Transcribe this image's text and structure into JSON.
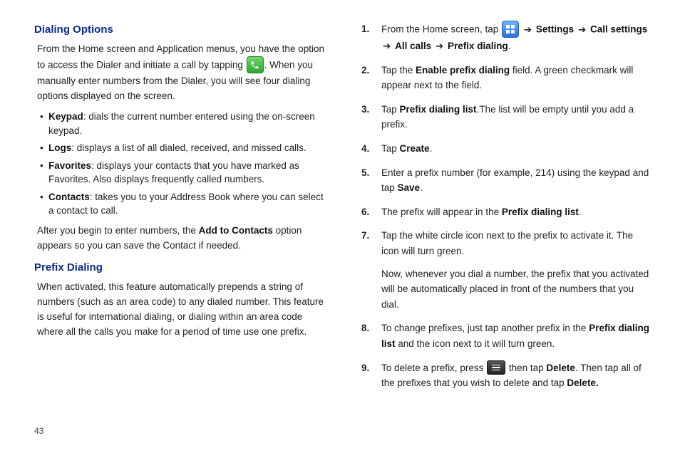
{
  "page_number": "43",
  "left": {
    "section1_title": "Dialing Options",
    "p1a": "From the Home screen and Application menus, you have the option to access the Dialer and initiate a call by tapping ",
    "p1b": ". When you manually enter numbers from the Dialer, you will see four dialing options displayed on the screen.",
    "bullets": [
      {
        "label": "Keypad",
        "text": ": dials the current number entered using the on-screen keypad."
      },
      {
        "label": "Logs",
        "text": ": displays a list of all dialed, received, and missed calls."
      },
      {
        "label": "Favorites",
        "text": ": displays your contacts that you have marked as Favorites. Also displays frequently called numbers."
      },
      {
        "label": "Contacts",
        "text": ": takes you to your Address Book where you can select a contact to call."
      }
    ],
    "p_after_bullets_a": "After you begin to enter numbers, the ",
    "add_to_contacts": "Add to Contacts",
    "p_after_bullets_b": " option appears so you can save the Contact if needed.",
    "section2_title": "Prefix Dialing",
    "p_prefix": "When activated, this feature automatically prepends a string of numbers (such as an area code) to any dialed number. This feature is useful for international dialing, or dialing within an area code where all the calls you make for a period of time use one prefix."
  },
  "right": {
    "arrow": "➔",
    "step1_a": "From the Home screen, tap ",
    "step1_settings": "Settings",
    "step1_callsettings": "Call settings",
    "step1_allcalls": "All calls",
    "step1_prefixdialing": "Prefix dialing",
    "step1_period": ".",
    "step2_a": "Tap the ",
    "step2_b": "Enable prefix dialing",
    "step2_c": " field. A green checkmark will appear next to the field.",
    "step3_a": "Tap ",
    "step3_b": "Prefix dialing list",
    "step3_c": ".The list will be empty until you add a prefix.",
    "step4_a": "Tap ",
    "step4_b": "Create",
    "step4_c": ".",
    "step5_a": "Enter a prefix number (for example, 214) using the keypad and tap ",
    "step5_b": "Save",
    "step5_c": ".",
    "step6_a": "The prefix will appear in the ",
    "step6_b": "Prefix dialing list",
    "step6_c": ".",
    "step7_a": "Tap the white circle icon next to the prefix to activate it. The icon will turn green.",
    "step7_sub": "Now, whenever you dial a number, the prefix that you activated will be automatically placed in front of the numbers that you dial.",
    "step8_a": "To change prefixes, just tap another prefix in the ",
    "step8_b": "Prefix dialing list",
    "step8_c": " and the icon next to it will turn green.",
    "step9_a": "To delete a prefix, press ",
    "step9_b": " then tap ",
    "step9_delete1": "Delete",
    "step9_c": ". Then tap all of the prefixes that you wish to delete and tap ",
    "step9_delete2": "Delete."
  }
}
